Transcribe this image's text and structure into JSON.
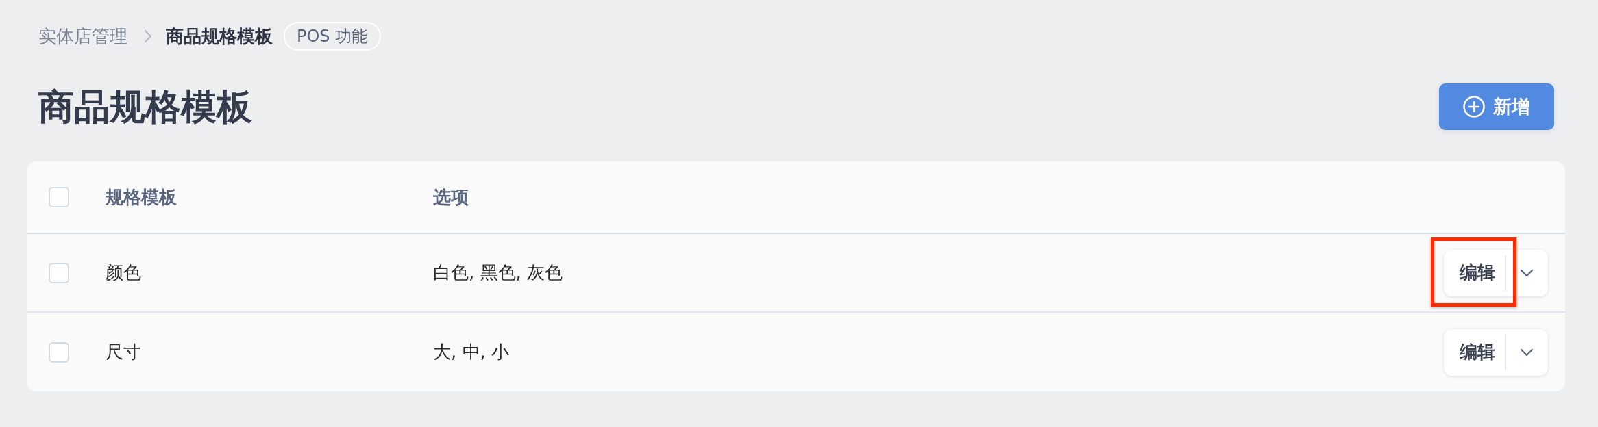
{
  "breadcrumb": {
    "items": [
      {
        "label": "实体店管理",
        "current": false
      },
      {
        "label": "商品规格模板",
        "current": true
      }
    ],
    "badge": "POS 功能"
  },
  "page_title": "商品规格模板",
  "add_button": {
    "label": "新增"
  },
  "table": {
    "select_all": {
      "checked": false
    },
    "columns": [
      "规格模板",
      "选项"
    ],
    "rows": [
      {
        "checked": false,
        "name": "颜色",
        "options": "白色, 黑色, 灰色",
        "action": "编辑",
        "highlighted": true
      },
      {
        "checked": false,
        "name": "尺寸",
        "options": "大, 中, 小",
        "action": "编辑",
        "highlighted": false
      }
    ]
  }
}
